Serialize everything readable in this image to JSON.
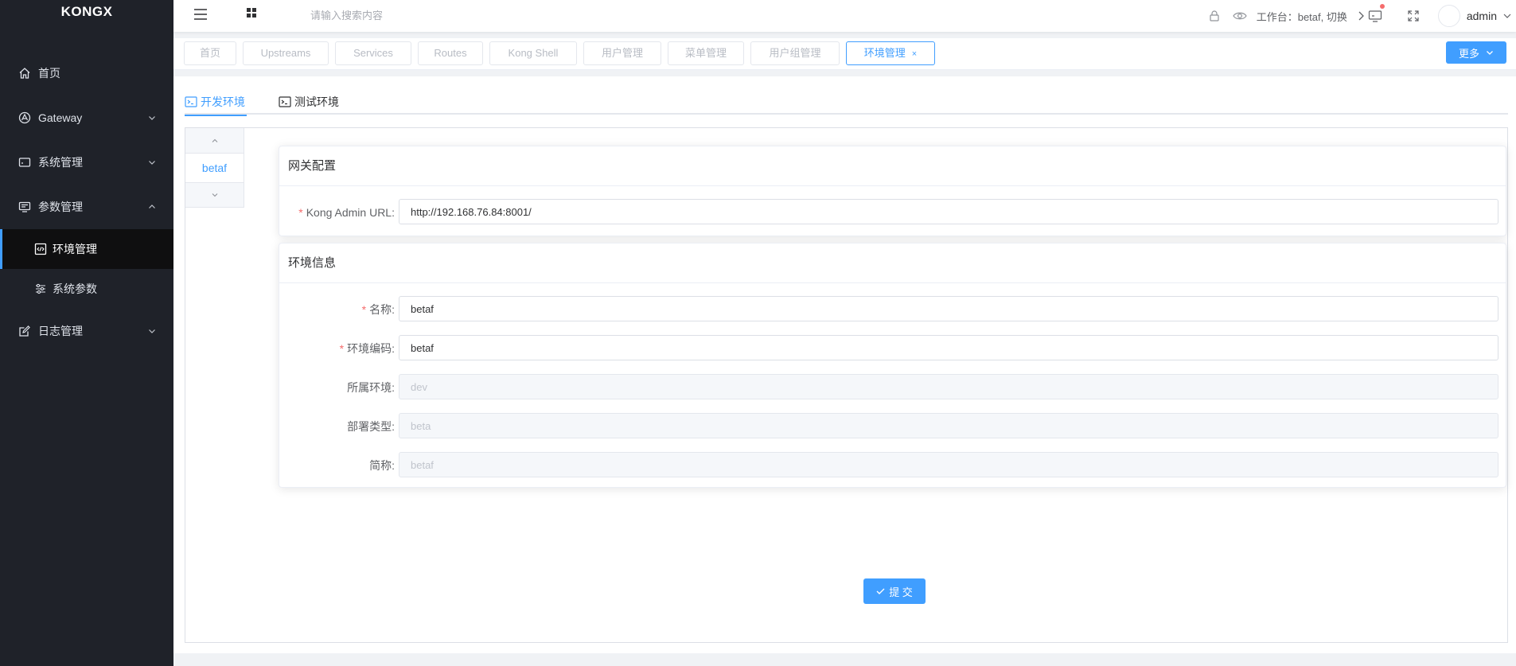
{
  "app": {
    "logo": "KONGX"
  },
  "sidebar": {
    "items": [
      {
        "label": "首页",
        "icon": "home-icon"
      },
      {
        "label": "Gateway",
        "icon": "gateway-icon"
      },
      {
        "label": "系统管理",
        "icon": "system-icon"
      },
      {
        "label": "参数管理",
        "icon": "params-icon"
      },
      {
        "label": "日志管理",
        "icon": "log-icon"
      }
    ],
    "submenu": [
      {
        "label": "环境管理",
        "icon": "code-icon",
        "active": true
      },
      {
        "label": "系统参数",
        "icon": "sliders-icon",
        "active": false
      }
    ]
  },
  "header": {
    "search_placeholder": "请输入搜索内容",
    "workspace": "工作台：betaf, 切换",
    "username": "admin"
  },
  "tags": [
    "首页",
    "Upstreams",
    "Services",
    "Routes",
    "Kong Shell",
    "用户管理",
    "菜单管理",
    "用户组管理",
    "环境管理"
  ],
  "tags_close": "×",
  "more_button": "更多",
  "env_tabs": [
    "开发环境",
    "测试环境"
  ],
  "vtab_item": "betaf",
  "gateway_card": {
    "title": "网关配置",
    "fields": [
      {
        "label": "Kong Admin URL:",
        "required": "*",
        "value": "http://192.168.76.84:8001/"
      }
    ]
  },
  "env_card": {
    "title": "环境信息",
    "fields": [
      {
        "label": "名称:",
        "required": "*",
        "value": "betaf"
      },
      {
        "label": "环境编码:",
        "required": "*",
        "value": "betaf"
      },
      {
        "label": "所属环境:",
        "required": "",
        "value": "dev"
      },
      {
        "label": "部署类型:",
        "required": "",
        "value": "beta"
      },
      {
        "label": "简称:",
        "required": "",
        "value": "betaf"
      }
    ]
  },
  "submit_button": "提 交",
  "colors": {
    "primary": "#409eff",
    "sidebar_bg": "#1f2229",
    "required": "#f56c6c"
  }
}
